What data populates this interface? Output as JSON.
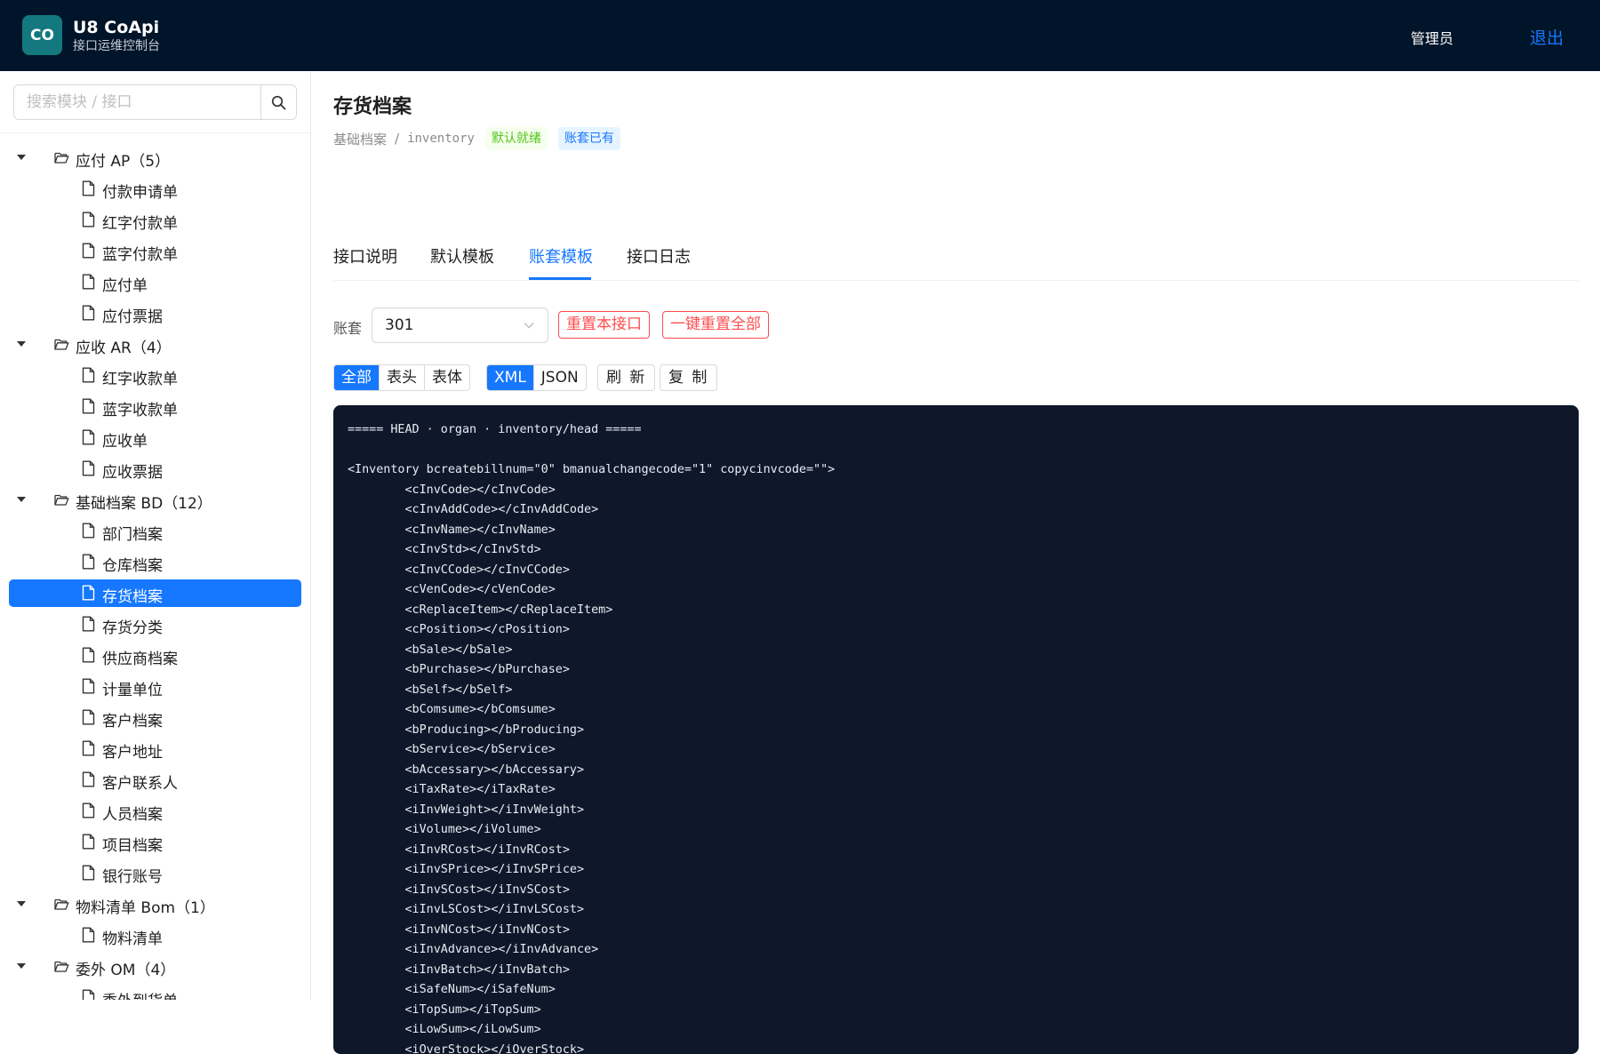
{
  "header": {
    "logo_text": "CO",
    "app_name": "U8 CoApi",
    "subtitle": "接口运维控制台",
    "user": "管理员",
    "logout": "退出"
  },
  "sidebar": {
    "search_placeholder": "搜索模块 / 接口",
    "tree": [
      {
        "label": "应付 AP（5）",
        "type": "group"
      },
      {
        "label": "付款申请单",
        "type": "leaf"
      },
      {
        "label": "红字付款单",
        "type": "leaf"
      },
      {
        "label": "蓝字付款单",
        "type": "leaf"
      },
      {
        "label": "应付单",
        "type": "leaf"
      },
      {
        "label": "应付票据",
        "type": "leaf"
      },
      {
        "label": "应收 AR（4）",
        "type": "group"
      },
      {
        "label": "红字收款单",
        "type": "leaf"
      },
      {
        "label": "蓝字收款单",
        "type": "leaf"
      },
      {
        "label": "应收单",
        "type": "leaf"
      },
      {
        "label": "应收票据",
        "type": "leaf"
      },
      {
        "label": "基础档案 BD（12）",
        "type": "group"
      },
      {
        "label": "部门档案",
        "type": "leaf"
      },
      {
        "label": "仓库档案",
        "type": "leaf"
      },
      {
        "label": "存货档案",
        "type": "leaf",
        "active": true
      },
      {
        "label": "存货分类",
        "type": "leaf"
      },
      {
        "label": "供应商档案",
        "type": "leaf"
      },
      {
        "label": "计量单位",
        "type": "leaf"
      },
      {
        "label": "客户档案",
        "type": "leaf"
      },
      {
        "label": "客户地址",
        "type": "leaf"
      },
      {
        "label": "客户联系人",
        "type": "leaf"
      },
      {
        "label": "人员档案",
        "type": "leaf"
      },
      {
        "label": "项目档案",
        "type": "leaf"
      },
      {
        "label": "银行账号",
        "type": "leaf"
      },
      {
        "label": "物料清单 Bom（1）",
        "type": "group"
      },
      {
        "label": "物料清单",
        "type": "leaf"
      },
      {
        "label": "委外 OM（4）",
        "type": "group"
      },
      {
        "label": "委外到货单",
        "type": "leaf"
      }
    ]
  },
  "main": {
    "title": "存货档案",
    "breadcrumb_module": "基础档案",
    "breadcrumb_sep": "/",
    "breadcrumb_code": "inventory",
    "tag_default": "默认就绪",
    "tag_account": "账套已有",
    "tabs": [
      "接口说明",
      "默认模板",
      "账套模板",
      "接口日志"
    ],
    "active_tab": 2,
    "account_label": "账套",
    "account_value": "301",
    "reset_one": "重置本接口",
    "reset_all": "一键重置全部",
    "scope_options": [
      "全部",
      "表头",
      "表体"
    ],
    "scope_selected": 0,
    "format_options": [
      "XML",
      "JSON"
    ],
    "format_selected": 0,
    "refresh": "刷 新",
    "copy": "复 制",
    "code_lines": [
      "===== HEAD · organ · inventory/head =====",
      "",
      "<Inventory bcreatebillnum=\"0\" bmanualchangecode=\"1\" copycinvcode=\"\">",
      "        <cInvCode></cInvCode>",
      "        <cInvAddCode></cInvAddCode>",
      "        <cInvName></cInvName>",
      "        <cInvStd></cInvStd>",
      "        <cInvCCode></cInvCCode>",
      "        <cVenCode></cVenCode>",
      "        <cReplaceItem></cReplaceItem>",
      "        <cPosition></cPosition>",
      "        <bSale></bSale>",
      "        <bPurchase></bPurchase>",
      "        <bSelf></bSelf>",
      "        <bComsume></bComsume>",
      "        <bProducing></bProducing>",
      "        <bService></bService>",
      "        <bAccessary></bAccessary>",
      "        <iTaxRate></iTaxRate>",
      "        <iInvWeight></iInvWeight>",
      "        <iVolume></iVolume>",
      "        <iInvRCost></iInvRCost>",
      "        <iInvSPrice></iInvSPrice>",
      "        <iInvSCost></iInvSCost>",
      "        <iInvLSCost></iInvLSCost>",
      "        <iInvNCost></iInvNCost>",
      "        <iInvAdvance></iInvAdvance>",
      "        <iInvBatch></iInvBatch>",
      "        <iSafeNum></iSafeNum>",
      "        <iTopSum></iTopSum>",
      "        <iLowSum></iLowSum>",
      "        <iOverStock></iOverStock>"
    ]
  }
}
